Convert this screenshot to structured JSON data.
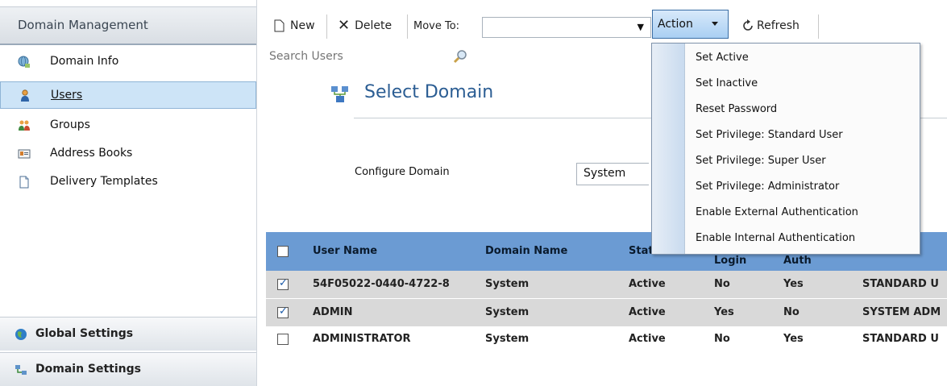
{
  "sidebar": {
    "header": "Domain Management",
    "items": [
      {
        "label": "Domain Info",
        "icon": "globe-network-icon"
      },
      {
        "label": "Users",
        "icon": "user-icon",
        "selected": true
      },
      {
        "label": "Groups",
        "icon": "group-icon"
      },
      {
        "label": "Address Books",
        "icon": "address-card-icon"
      },
      {
        "label": "Delivery Templates",
        "icon": "document-icon"
      }
    ],
    "footer": [
      {
        "label": "Global Settings",
        "icon": "globe-icon"
      },
      {
        "label": "Domain Settings",
        "icon": "domain-network-icon"
      }
    ]
  },
  "toolbar": {
    "new_label": "New",
    "delete_label": "Delete",
    "move_to_label": "Move To:",
    "move_to_value": "",
    "action_label": "Action",
    "refresh_label": "Refresh"
  },
  "search": {
    "placeholder": "Search Users"
  },
  "domain_panel": {
    "title": "Select Domain",
    "configure_label": "Configure Domain",
    "domain_value": "System"
  },
  "grid": {
    "headers": [
      "User Name",
      "Domain Name",
      "Stat",
      "Login",
      "Auth"
    ],
    "rows": [
      {
        "checked": true,
        "user": "54F05022-0440-4722-8",
        "domain": "System",
        "status": "Active",
        "login": "No",
        "auth": "Yes",
        "privilege": "STANDARD U"
      },
      {
        "checked": true,
        "user": "ADMIN",
        "domain": "System",
        "status": "Active",
        "login": "Yes",
        "auth": "No",
        "privilege": "SYSTEM ADM"
      },
      {
        "checked": false,
        "user": "ADMINISTRATOR",
        "domain": "System",
        "status": "Active",
        "login": "No",
        "auth": "Yes",
        "privilege": "STANDARD U"
      }
    ]
  },
  "action_menu": {
    "items": [
      "Set Active",
      "Set Inactive",
      "Reset Password",
      "Set Privilege: Standard User",
      "Set Privilege: Super User",
      "Set Privilege: Administrator",
      "Enable External Authentication",
      "Enable Internal Authentication"
    ]
  },
  "colors": {
    "grid_header": "#6b9bd3",
    "selected_item": "#cde4f7",
    "title": "#2b5d93"
  }
}
